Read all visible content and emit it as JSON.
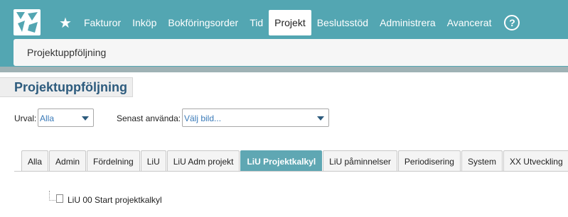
{
  "nav": {
    "items": [
      {
        "label": "Fakturor"
      },
      {
        "label": "Inköp"
      },
      {
        "label": "Bokföringsorder"
      },
      {
        "label": "Tid"
      },
      {
        "label": "Projekt"
      },
      {
        "label": "Beslutsstöd"
      },
      {
        "label": "Administrera"
      },
      {
        "label": "Avancerat"
      }
    ],
    "active": "Projekt",
    "help": "?"
  },
  "breadcrumb": "Projektuppföljning",
  "page_title": "Projektuppföljning",
  "filters": {
    "urval_label": "Urval:",
    "urval_value": "Alla",
    "senast_label": "Senast använda:",
    "senast_value": "Välj bild..."
  },
  "tabs": [
    {
      "label": "Alla"
    },
    {
      "label": "Admin"
    },
    {
      "label": "Fördelning"
    },
    {
      "label": "LiU"
    },
    {
      "label": "LiU Adm projekt"
    },
    {
      "label": "LiU Projektkalkyl"
    },
    {
      "label": "LiU påminnelser"
    },
    {
      "label": "Periodisering"
    },
    {
      "label": "System"
    },
    {
      "label": "XX Utveckling"
    }
  ],
  "active_tab": "LiU Projektkalkyl",
  "tree": {
    "items": [
      {
        "label": "LiU 00 Start projektkalkyl"
      }
    ]
  },
  "colors": {
    "header": "#53a6b2",
    "active_tab": "#5fa7b3",
    "title": "#2d5b7d",
    "link": "#3a7ab8"
  }
}
